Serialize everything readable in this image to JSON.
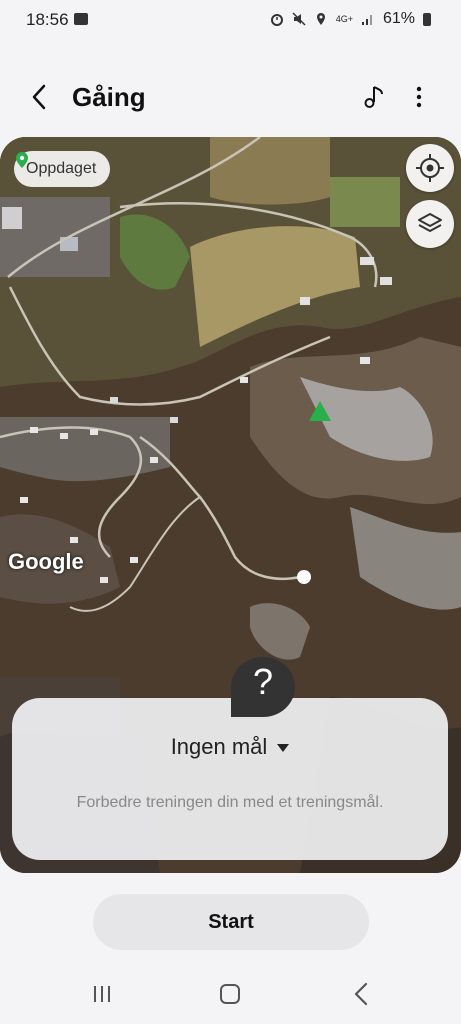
{
  "status": {
    "time": "18:56",
    "battery": "61%",
    "network": "4G+",
    "icons": [
      "alarm-icon",
      "mute-icon",
      "location-icon",
      "signal-icon",
      "battery-icon"
    ]
  },
  "appbar": {
    "title": "Gåing"
  },
  "map": {
    "discovered_label": "Oppdaget",
    "attribution": "Google",
    "buttons": [
      "my-location-icon",
      "layers-icon"
    ]
  },
  "goal_panel": {
    "help_symbol": "?",
    "goal_label": "Ingen mål",
    "hint": "Forbedre treningen din med et treningsmål."
  },
  "start_label": "Start",
  "colors": {
    "accent_green": "#27b04c",
    "background": "#f4f4f6"
  }
}
